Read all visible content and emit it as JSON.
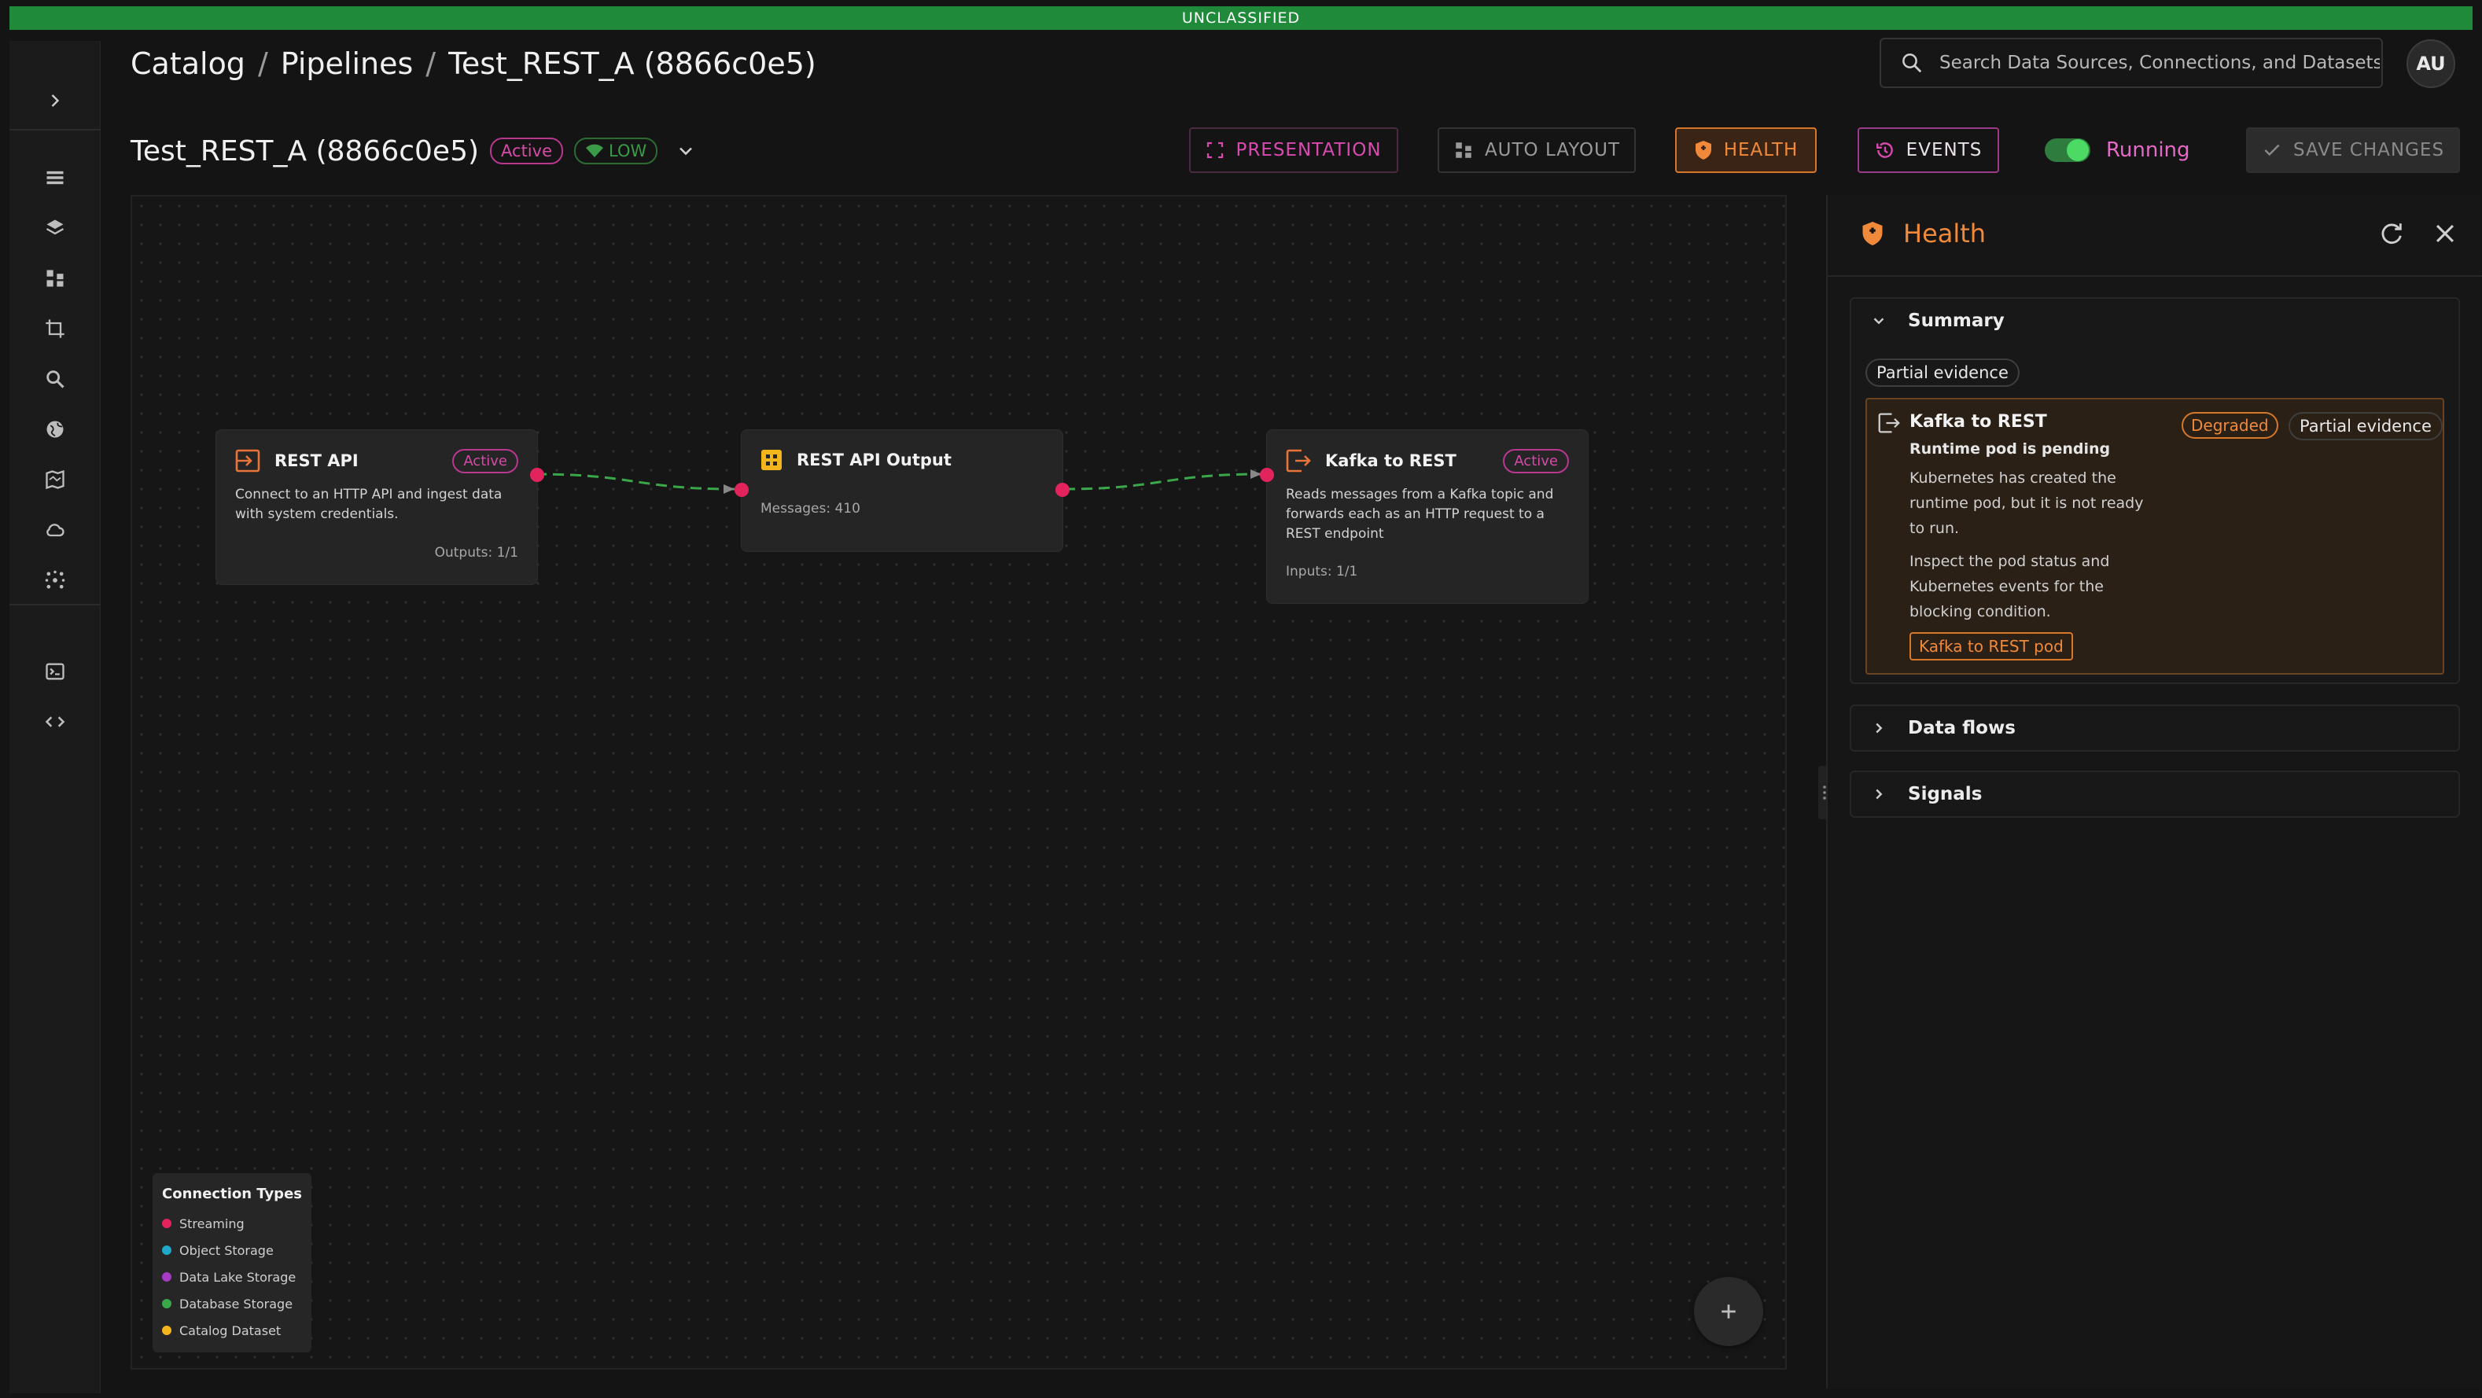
{
  "classification": "UNCLASSIFIED",
  "breadcrumb": {
    "catalog": "Catalog",
    "pipelines": "Pipelines",
    "current": "Test_REST_A (8866c0e5)",
    "separator": "/"
  },
  "search": {
    "placeholder": "Search Data Sources, Connections, and Datasets"
  },
  "user": {
    "initials": "AU"
  },
  "pipeline": {
    "name": "Test_REST_A (8866c0e5)",
    "status": "Active",
    "priority": "LOW"
  },
  "toolbar": {
    "presentation": "PRESENTATION",
    "auto_layout": "AUTO LAYOUT",
    "health": "HEALTH",
    "events": "EVENTS",
    "running_label": "Running",
    "save": "SAVE CHANGES"
  },
  "nodes": [
    {
      "title": "REST API",
      "badge": "Active",
      "description_lines": [
        "Connect to an HTTP API and ingest data",
        "with system credentials."
      ],
      "footer": "Outputs: 1/1"
    },
    {
      "title": "REST API Output",
      "footer": "Messages: 410"
    },
    {
      "title": "Kafka to REST",
      "badge": "Active",
      "description_lines": [
        "Reads messages from a Kafka topic and",
        "forwards each as an HTTP request to a",
        "REST endpoint"
      ],
      "footer": "Inputs: 1/1"
    }
  ],
  "legend": {
    "title": "Connection Types",
    "items": [
      {
        "label": "Streaming",
        "color": "#e3245c"
      },
      {
        "label": "Object Storage",
        "color": "#1fa8c9"
      },
      {
        "label": "Data Lake Storage",
        "color": "#a43bc4"
      },
      {
        "label": "Database Storage",
        "color": "#3aa84a"
      },
      {
        "label": "Catalog Dataset",
        "color": "#f2b51c"
      }
    ]
  },
  "health_panel": {
    "title": "Health",
    "summary": {
      "title": "Summary",
      "evidence": "Partial evidence",
      "card": {
        "name": "Kafka to REST",
        "state": "Degraded",
        "evidence": "Partial evidence",
        "subtitle": "Runtime pod is pending",
        "text1_lines": [
          "Kubernetes has created the",
          "runtime pod, but it is not ready",
          "to run."
        ],
        "text2_lines": [
          "Inspect the pod status and",
          "Kubernetes events for the",
          "blocking condition."
        ],
        "link": "Kafka to REST pod"
      }
    },
    "data_flows": "Data flows",
    "signals": "Signals"
  },
  "colors": {
    "accent_orange": "#f08a3a",
    "accent_pink": "#d64aa8",
    "classification_green": "#1e8a3a",
    "edge_green": "#3aa84a",
    "port_red": "#e3245c"
  }
}
